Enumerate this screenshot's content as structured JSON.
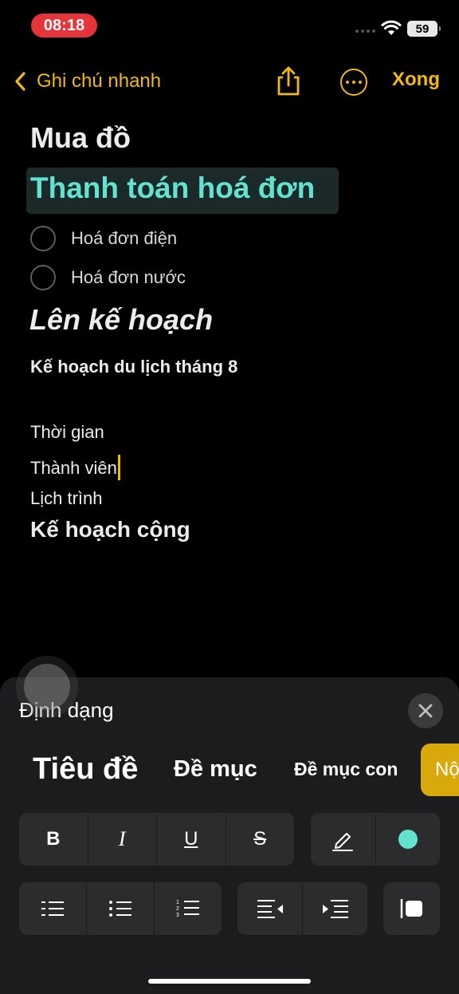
{
  "status": {
    "time": "08:18",
    "battery": "59"
  },
  "nav": {
    "back_label": "Ghi chú nhanh",
    "done_label": "Xong"
  },
  "note": {
    "title": "Mua đồ",
    "highlight_heading": "Thanh toán hoá đơn",
    "checklist": [
      {
        "label": "Hoá đơn điện",
        "checked": false
      },
      {
        "label": "Hoá đơn nước",
        "checked": false
      }
    ],
    "italic_heading": "Lên kế hoạch",
    "subheading": "Kế hoạch du lịch tháng 8",
    "lines": [
      "Thời gian",
      "Thành viên",
      "Lịch trình"
    ],
    "bold_line": "Kế hoạch cộng"
  },
  "format_panel": {
    "title": "Định dạng",
    "styles": [
      "Tiêu đề",
      "Đề mục",
      "Đề mục con",
      "Nộ"
    ],
    "text_buttons": {
      "bold": "B",
      "italic": "I",
      "underline": "U",
      "strikethrough": "S"
    },
    "highlight_color": "#63e2d0",
    "accent_color": "#f0b90b",
    "icons": [
      "pencil-highlight-icon",
      "color-dot-icon",
      "dashed-list-icon",
      "bulleted-list-icon",
      "numbered-list-icon",
      "indent-decrease-icon",
      "indent-increase-icon",
      "block-quote-icon"
    ]
  }
}
